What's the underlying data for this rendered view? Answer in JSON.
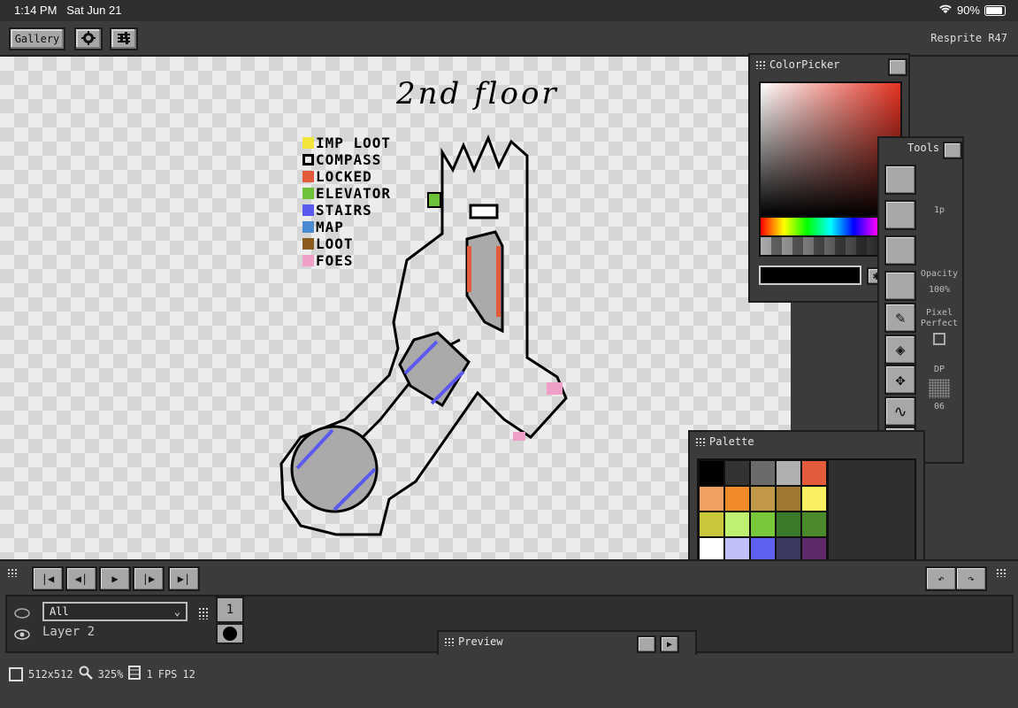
{
  "status_bar": {
    "time": "1:14 PM",
    "date": "Sat Jun 21",
    "battery": "90%",
    "battery_level": 0.9
  },
  "toolbar": {
    "gallery_label": "Gallery",
    "settings_icon": "gear-icon",
    "sliders_icon": "sliders-icon",
    "app_name": "Resprite R47"
  },
  "canvas": {
    "title": "2nd floor",
    "legend": [
      {
        "label": "IMP LOOT",
        "color": "#f2e43a"
      },
      {
        "label": "COMPASS",
        "color": "#000000"
      },
      {
        "label": "LOCKED",
        "color": "#e35b3a"
      },
      {
        "label": "ELEVATOR",
        "color": "#6dc23a"
      },
      {
        "label": "STAIRS",
        "color": "#5a5af0"
      },
      {
        "label": "MAP",
        "color": "#4a8ad0"
      },
      {
        "label": "LOOT",
        "color": "#8a5a1e"
      },
      {
        "label": "FOES",
        "color": "#f0a0c8"
      }
    ]
  },
  "color_picker": {
    "title": "ColorPicker",
    "hex_value": "",
    "selected_hue": "#e53222"
  },
  "tools": {
    "title": "Tools",
    "brush_size": "1p",
    "opacity_label": "Opacity",
    "opacity_value": "100%",
    "pixel_perfect_label": "Pixel Perfect",
    "dither_label": "DP",
    "dither_value": "06"
  },
  "palette": {
    "title": "Palette",
    "colors": [
      "#000000",
      "#333333",
      "#6b6b6b",
      "#b0b0b0",
      "#e35b3a",
      "#f0a060",
      "#f08a2a",
      "#c09848",
      "#a07830",
      "#f8f060",
      "#c8c83a",
      "#c0f070",
      "#78c83a",
      "#3a7a2a",
      "#4a8a2a",
      "#ffffff",
      "#c0c0f8",
      "#6060f0",
      "#3a3a60",
      "#602a6a",
      "#906a8a",
      "#f0a0c8"
    ]
  },
  "preview": {
    "title": "Preview"
  },
  "timeline": {
    "layer_filter": "All",
    "layer_name": "Layer 2",
    "frame_number": "1"
  },
  "bottom_bar": {
    "canvas_size": "512x512",
    "zoom": "325%",
    "frames": "1",
    "fps_label": "FPS",
    "fps_value": "12"
  }
}
